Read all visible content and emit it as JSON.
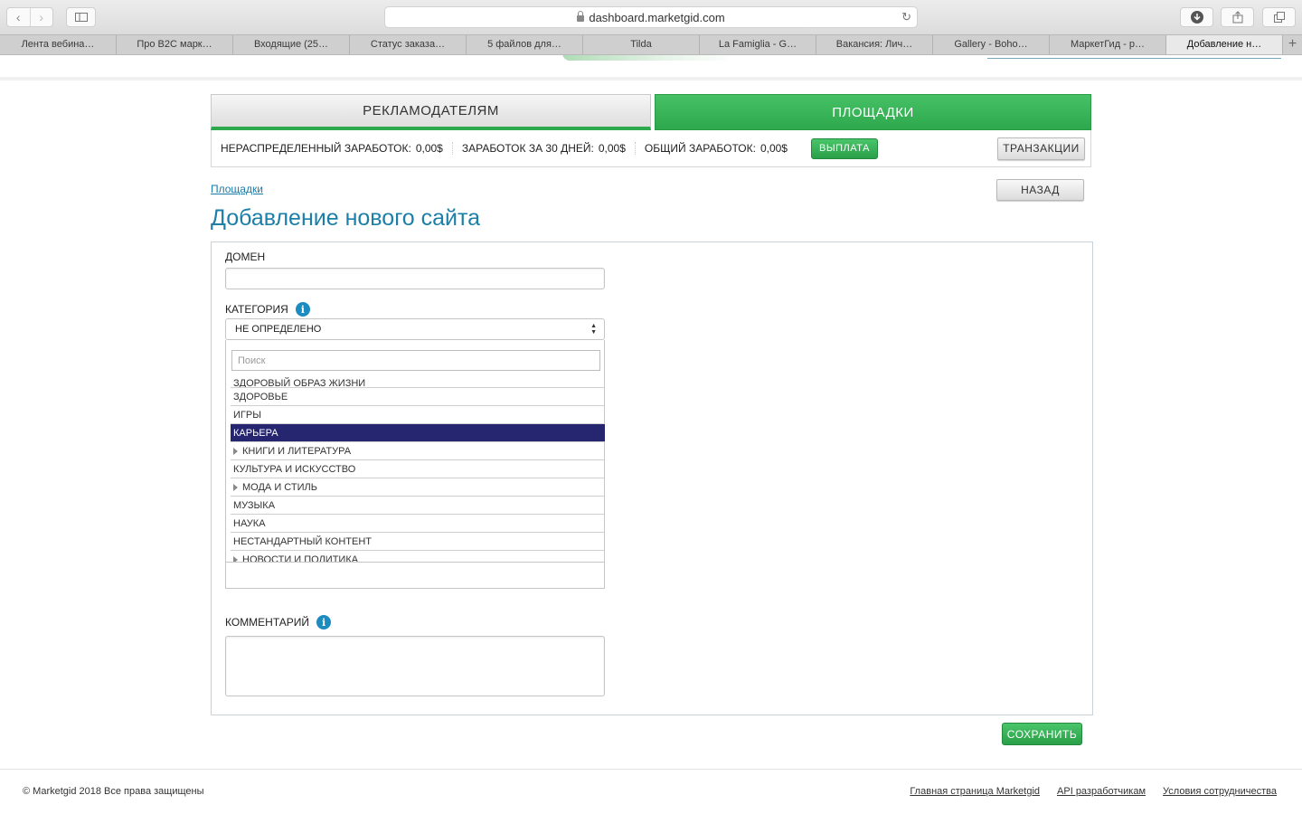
{
  "browser": {
    "url": "dashboard.marketgid.com",
    "tabs": [
      {
        "label": "Лента вебина…"
      },
      {
        "label": "Про B2C марк…"
      },
      {
        "label": "Входящие (25…"
      },
      {
        "label": "Статус заказа…"
      },
      {
        "label": "5 файлов для…"
      },
      {
        "label": "Tilda"
      },
      {
        "label": "La Famiglia - G…"
      },
      {
        "label": "Вакансия: Лич…"
      },
      {
        "label": "Gallery - Boho…"
      },
      {
        "label": "МаркетГид - р…"
      },
      {
        "label": "Добавление н…"
      }
    ],
    "new_tab": "+"
  },
  "main_tabs": {
    "advertisers": "РЕКЛАМОДАТЕЛЯМ",
    "sites": "ПЛОЩАДКИ"
  },
  "earnings": {
    "unallocated_label": "НЕРАСПРЕДЕЛЕННЫЙ ЗАРАБОТОК:",
    "unallocated_value": "0,00$",
    "last30_label": "ЗАРАБОТОК ЗА 30 ДНЕЙ:",
    "last30_value": "0,00$",
    "total_label": "ОБЩИЙ ЗАРАБОТОК:",
    "total_value": "0,00$",
    "payout_button": "ВЫПЛАТА",
    "transactions_button": "ТРАНЗАКЦИИ"
  },
  "breadcrumb": "Площадки",
  "back_button": "НАЗАД",
  "page_title": "Добавление нового сайта",
  "form": {
    "domain_label": "ДОМЕН",
    "domain_value": "",
    "category_label": "КАТЕГОРИЯ",
    "category_selected": "НЕ ОПРЕДЕЛЕНО",
    "search_placeholder": "Поиск",
    "category_items": [
      {
        "label": "ЗДОРОВЫЙ ОБРАЗ ЖИЗНИ",
        "expandable": false,
        "selected": false
      },
      {
        "label": "ЗДОРОВЬЕ",
        "expandable": false,
        "selected": false
      },
      {
        "label": "ИГРЫ",
        "expandable": false,
        "selected": false
      },
      {
        "label": "КАРЬЕРА",
        "expandable": false,
        "selected": true
      },
      {
        "label": "КНИГИ И ЛИТЕРАТУРА",
        "expandable": true,
        "selected": false
      },
      {
        "label": "КУЛЬТУРА И ИСКУССТВО",
        "expandable": false,
        "selected": false
      },
      {
        "label": "МОДА И СТИЛЬ",
        "expandable": true,
        "selected": false
      },
      {
        "label": "МУЗЫКА",
        "expandable": false,
        "selected": false
      },
      {
        "label": "НАУКА",
        "expandable": false,
        "selected": false
      },
      {
        "label": "НЕСТАНДАРТНЫЙ КОНТЕНТ",
        "expandable": false,
        "selected": false
      },
      {
        "label": "НОВОСТИ И ПОЛИТИКА",
        "expandable": true,
        "selected": false
      }
    ],
    "comment_label": "КОММЕНТАРИЙ",
    "comment_value": "",
    "save_button": "СОХРАНИТЬ"
  },
  "footer": {
    "copyright": "© Marketgid 2018 Все права защищены",
    "links": [
      "Главная страница Marketgid",
      "API разработчикам",
      "Условия сотрудничества"
    ]
  },
  "colors": {
    "accent_green": "#2ea84d",
    "title_blue": "#1b7fa8",
    "selected_item": "#262670"
  }
}
